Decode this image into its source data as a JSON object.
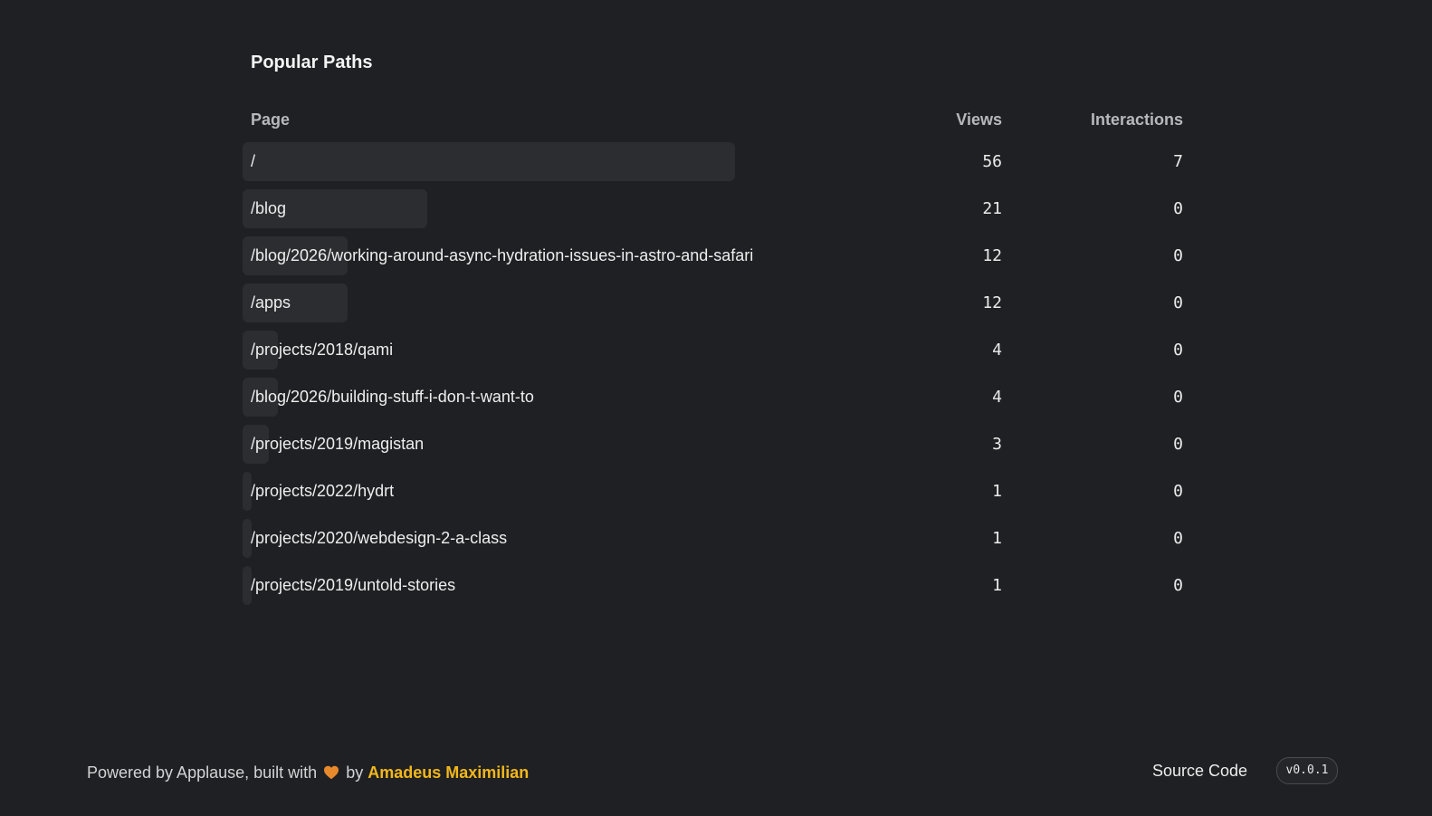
{
  "section": {
    "title": "Popular Paths"
  },
  "table": {
    "headers": {
      "page": "Page",
      "views": "Views",
      "interactions": "Interactions"
    },
    "rows": [
      {
        "page": "/",
        "views": "56",
        "interactions": "7",
        "share": 1.0
      },
      {
        "page": "/blog",
        "views": "21",
        "interactions": "0",
        "share": 0.375
      },
      {
        "page": "/blog/2026/working-around-async-hydration-issues-in-astro-and-safari",
        "views": "12",
        "interactions": "0",
        "share": 0.214
      },
      {
        "page": "/apps",
        "views": "12",
        "interactions": "0",
        "share": 0.214
      },
      {
        "page": "/projects/2018/qami",
        "views": "4",
        "interactions": "0",
        "share": 0.071
      },
      {
        "page": "/blog/2026/building-stuff-i-don-t-want-to",
        "views": "4",
        "interactions": "0",
        "share": 0.071
      },
      {
        "page": "/projects/2019/magistan",
        "views": "3",
        "interactions": "0",
        "share": 0.054
      },
      {
        "page": "/projects/2022/hydrt",
        "views": "1",
        "interactions": "0",
        "share": 0.018
      },
      {
        "page": "/projects/2020/webdesign-2-a-class",
        "views": "1",
        "interactions": "0",
        "share": 0.018
      },
      {
        "page": "/projects/2019/untold-stories",
        "views": "1",
        "interactions": "0",
        "share": 0.018
      }
    ]
  },
  "footer": {
    "powered_prefix": "Powered by Applause, built with",
    "heart_icon": "heart-icon",
    "by": "by",
    "author": "Amadeus Maximilian",
    "source_code": "Source Code",
    "version": "v0.0.1"
  },
  "colors": {
    "background": "#1f2023",
    "bar": "#2c2d30",
    "accent": "#f3b71b",
    "heart": "#e8892b"
  }
}
